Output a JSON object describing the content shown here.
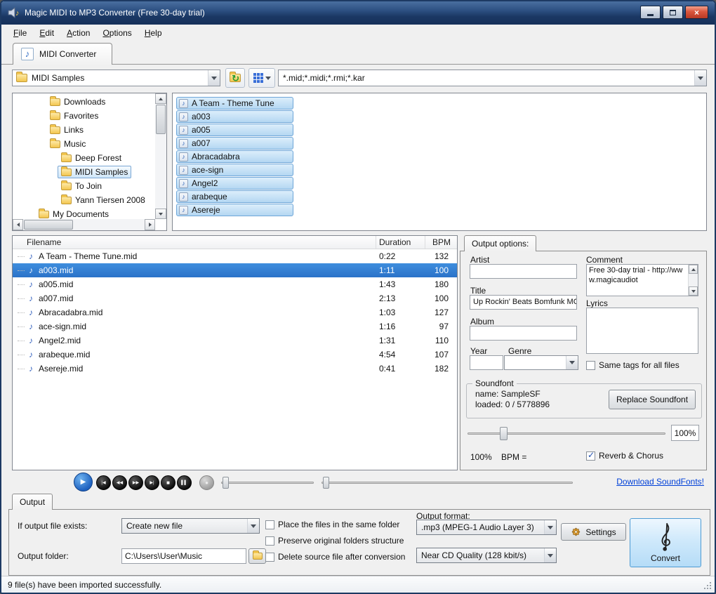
{
  "window": {
    "title": "Magic MIDI to MP3 Converter (Free 30-day trial)"
  },
  "icons": {
    "close": "×",
    "note": "♪",
    "refresh": "↻"
  },
  "colors": {
    "selection_blue": "#2f7cd2",
    "link_blue": "#0040d8",
    "titlebar_blue": "#274a7c"
  },
  "menu_bar": {
    "items": [
      "File",
      "Edit",
      "Action",
      "Options",
      "Help"
    ]
  },
  "tabs": {
    "midi_converter": "MIDI Converter"
  },
  "toolbar": {
    "folder_combo_value": "MIDI Samples",
    "filter_combo_value": "*.mid;*.midi;*.rmi;*.kar"
  },
  "folder_tree": {
    "items": [
      {
        "label": "Downloads",
        "level": 1,
        "selected": false
      },
      {
        "label": "Favorites",
        "level": 1,
        "selected": false
      },
      {
        "label": "Links",
        "level": 1,
        "selected": false
      },
      {
        "label": "Music",
        "level": 1,
        "selected": false
      },
      {
        "label": "Deep Forest",
        "level": 2,
        "selected": false
      },
      {
        "label": "MIDI Samples",
        "level": 2,
        "selected": true
      },
      {
        "label": "To Join",
        "level": 2,
        "selected": false
      },
      {
        "label": "Yann Tiersen 2008",
        "level": 2,
        "selected": false
      },
      {
        "label": "My Documents",
        "level": 0,
        "selected": false
      }
    ]
  },
  "file_browser": {
    "items": [
      {
        "label": "A Team - Theme Tune",
        "selected": true
      },
      {
        "label": "a003",
        "selected": true
      },
      {
        "label": "a005",
        "selected": true
      },
      {
        "label": "a007",
        "selected": true
      },
      {
        "label": "Abracadabra",
        "selected": true
      },
      {
        "label": "ace-sign",
        "selected": true
      },
      {
        "label": "Angel2",
        "selected": true
      },
      {
        "label": "arabeque",
        "selected": true
      },
      {
        "label": "Asereje",
        "selected": true
      }
    ]
  },
  "file_table": {
    "columns": [
      "Filename",
      "Duration",
      "BPM"
    ],
    "rows": [
      {
        "filename": "A Team - Theme Tune.mid",
        "duration": "0:22",
        "bpm": "132",
        "selected": false
      },
      {
        "filename": "a003.mid",
        "duration": "1:11",
        "bpm": "100",
        "selected": true
      },
      {
        "filename": "a005.mid",
        "duration": "1:43",
        "bpm": "180",
        "selected": false
      },
      {
        "filename": "a007.mid",
        "duration": "2:13",
        "bpm": "100",
        "selected": false
      },
      {
        "filename": "Abracadabra.mid",
        "duration": "1:03",
        "bpm": "127",
        "selected": false
      },
      {
        "filename": "ace-sign.mid",
        "duration": "1:16",
        "bpm": "97",
        "selected": false
      },
      {
        "filename": "Angel2.mid",
        "duration": "1:31",
        "bpm": "110",
        "selected": false
      },
      {
        "filename": "arabeque.mid",
        "duration": "4:54",
        "bpm": "107",
        "selected": false
      },
      {
        "filename": "Asereje.mid",
        "duration": "0:41",
        "bpm": "182",
        "selected": false
      }
    ]
  },
  "output_options": {
    "tab_label": "Output options:",
    "artist_label": "Artist",
    "artist_value": "",
    "title_label": "Title",
    "title_value": "Up Rockin' Beats Bomfunk MC",
    "album_label": "Album",
    "album_value": "",
    "year_label": "Year",
    "year_value": "",
    "genre_label": "Genre",
    "genre_value": "",
    "comment_label": "Comment",
    "comment_value": "Free 30-day trial - http://www.magicaudiot",
    "lyrics_label": "Lyrics",
    "lyrics_value": "",
    "same_tags_label": "Same tags for all files",
    "same_tags_checked": false,
    "soundfont_group_label": "Soundfont",
    "soundfont_name": "name: SampleSF",
    "soundfont_loaded": "loaded: 0 / 5778896",
    "replace_soundfont_button": "Replace Soundfont",
    "volume_percent": "100%",
    "tempo_percent": "100%",
    "bpm_label": "BPM =",
    "reverb_chorus_label": "Reverb & Chorus",
    "reverb_chorus_checked": true
  },
  "player": {
    "buttons": [
      {
        "name": "play",
        "glyph": "▶"
      },
      {
        "name": "skip-back",
        "glyph": "|◀"
      },
      {
        "name": "rewind",
        "glyph": "◀◀"
      },
      {
        "name": "fast-forward",
        "glyph": "▶▶"
      },
      {
        "name": "skip-forward",
        "glyph": "▶|"
      },
      {
        "name": "stop",
        "glyph": "■"
      },
      {
        "name": "pause",
        "glyph": "▌▌"
      },
      {
        "name": "record",
        "glyph": "●"
      }
    ],
    "download_link": "Download SoundFonts!"
  },
  "output_panel": {
    "tab_label": "Output",
    "if_exists_label": "If output file exists:",
    "if_exists_value": "Create new file",
    "output_folder_label": "Output folder:",
    "output_folder_value": "C:\\Users\\User\\Music",
    "checkbox_same_folder": "Place the files in the same folder",
    "checkbox_same_folder_checked": false,
    "checkbox_preserve": "Preserve original folders structure",
    "checkbox_preserve_checked": false,
    "checkbox_delete": "Delete source file after conversion",
    "checkbox_delete_checked": false,
    "output_format_label": "Output format:",
    "output_format_value": ".mp3 (MPEG-1 Audio Layer 3)",
    "quality_value": "Near CD Quality (128 kbit/s)",
    "settings_button": "Settings",
    "convert_button": "Convert"
  },
  "status_bar": {
    "text": "9 file(s) have been imported successfully."
  }
}
